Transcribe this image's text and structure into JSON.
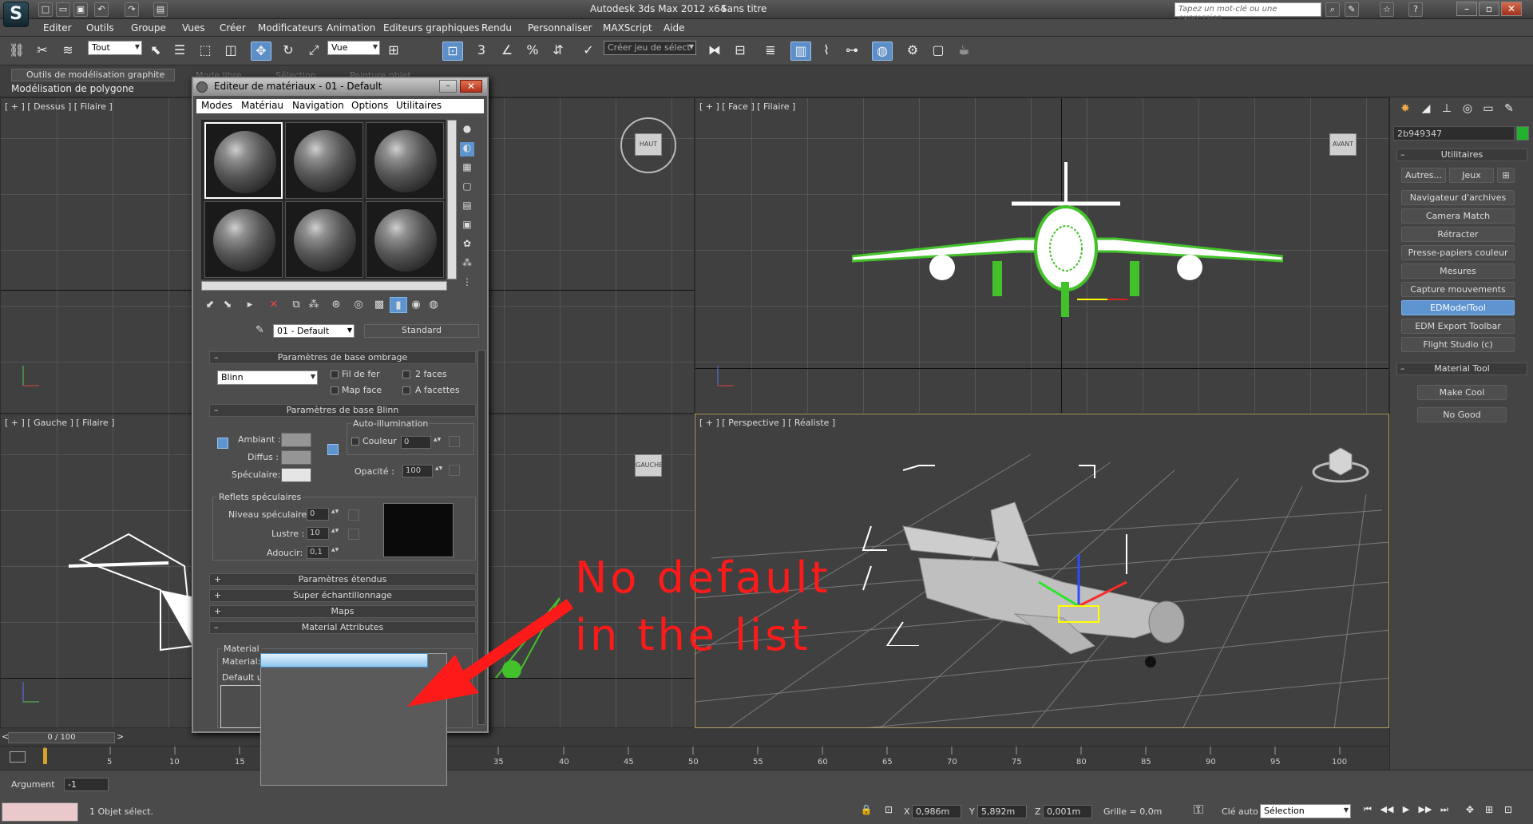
{
  "app": {
    "title": "Autodesk 3ds Max 2012 x64",
    "document": "Sans titre",
    "search_placeholder": "Tapez un mot-clé ou une expression"
  },
  "menus": [
    "Editer",
    "Outils",
    "Groupe",
    "Vues",
    "Créer",
    "Modificateurs",
    "Animation",
    "Editeurs graphiques",
    "Rendu",
    "Personnaliser",
    "MAXScript",
    "Aide"
  ],
  "toolbar": {
    "selection_filter": "Tout",
    "ref_coord": "Vue",
    "named_selection_placeholder": "Créer jeu de sélect"
  },
  "ribbon": {
    "tab_graphite": "Outils de modélisation graphite",
    "tab_poly": "Modélisation de polygone",
    "faded_mode": "Mode libre",
    "faded_selection": "Sélection",
    "faded_paint": "Peinture objet"
  },
  "viewports": {
    "top": "[ + ] [ Dessus ] [ Filaire ]",
    "front": "[ + ] [ Face ] [ Filaire ]",
    "left": "[ + ] [ Gauche ] [ Filaire ]",
    "perspective": "[ + ] [ Perspective ] [ Réaliste ]",
    "cube_top": "HAUT",
    "cube_front": "AVANT",
    "cube_left": "GAUCHE"
  },
  "command_panel": {
    "object_name": "2b949347",
    "utilities_title": "Utilitaires",
    "btn_more": "Autres...",
    "btn_sets": "Jeux",
    "items": [
      "Navigateur d'archives",
      "Camera Match",
      "Rétracter",
      "Presse-papiers couleur",
      "Mesures",
      "Capture mouvements",
      "EDModelTool",
      "EDM Export Toolbar",
      "Flight Studio (c)"
    ],
    "material_tool_title": "Material Tool",
    "make_cool": "Make Cool",
    "no_good": "No Good"
  },
  "material_editor": {
    "title": "Editeur de matériaux - 01 - Default",
    "menus": [
      "Modes",
      "Matériau",
      "Navigation",
      "Options",
      "Utilitaires"
    ],
    "material_name": "01 - Default",
    "material_type": "Standard",
    "shading_rollout": "Paramètres de base ombrage",
    "shader": "Blinn",
    "wire": "Fil de fer",
    "two_sided": "2 faces",
    "face_map": "Map face",
    "faceted": "A facettes",
    "blinn_rollout": "Paramètres de base Blinn",
    "self_illum": "Auto-illumination",
    "color_label": "Couleur",
    "color_value": "0",
    "ambient": "Ambiant :",
    "diffuse": "Diffus :",
    "specular": "Spéculaire:",
    "opacity_label": "Opacité :",
    "opacity_value": "100",
    "spec_highlights": "Reflets spéculaires",
    "spec_level_label": "Niveau spéculaire:",
    "spec_level": "0",
    "glossiness_label": "Lustre :",
    "glossiness": "10",
    "soften_label": "Adoucir:",
    "soften": "0,1",
    "extended_rollout": "Paramètres étendus",
    "supersampling_rollout": "Super échantillonnage",
    "maps_rollout": "Maps",
    "attributes_rollout": "Material Attributes",
    "attr_group": "Material",
    "attr_material_label": "Material:",
    "attr_default_label": "Default un"
  },
  "timeline": {
    "frame_counter": "0 / 100",
    "ticks": [
      "5",
      "10",
      "15",
      "35",
      "40",
      "45",
      "50",
      "55",
      "60",
      "65",
      "70",
      "75",
      "80",
      "85",
      "90",
      "95",
      "100"
    ]
  },
  "status": {
    "argument_label": "Argument",
    "argument_value": "-1",
    "selection_info": "1 Objet sélect.",
    "x_label": "X",
    "x_value": "0,986m",
    "y_label": "Y",
    "y_value": "5,892m",
    "z_label": "Z",
    "z_value": "0,001m",
    "grid": "Grille = 0,0m",
    "auto_key": "Clé auto",
    "key_filter": "Sélection"
  },
  "annotation": {
    "line1": "No default",
    "line2": "in the list"
  },
  "colors": {
    "accent": "#5e95d1",
    "annotation": "#ff1a1a",
    "wire_green": "#43c12b",
    "object_color": "#22b32e"
  }
}
